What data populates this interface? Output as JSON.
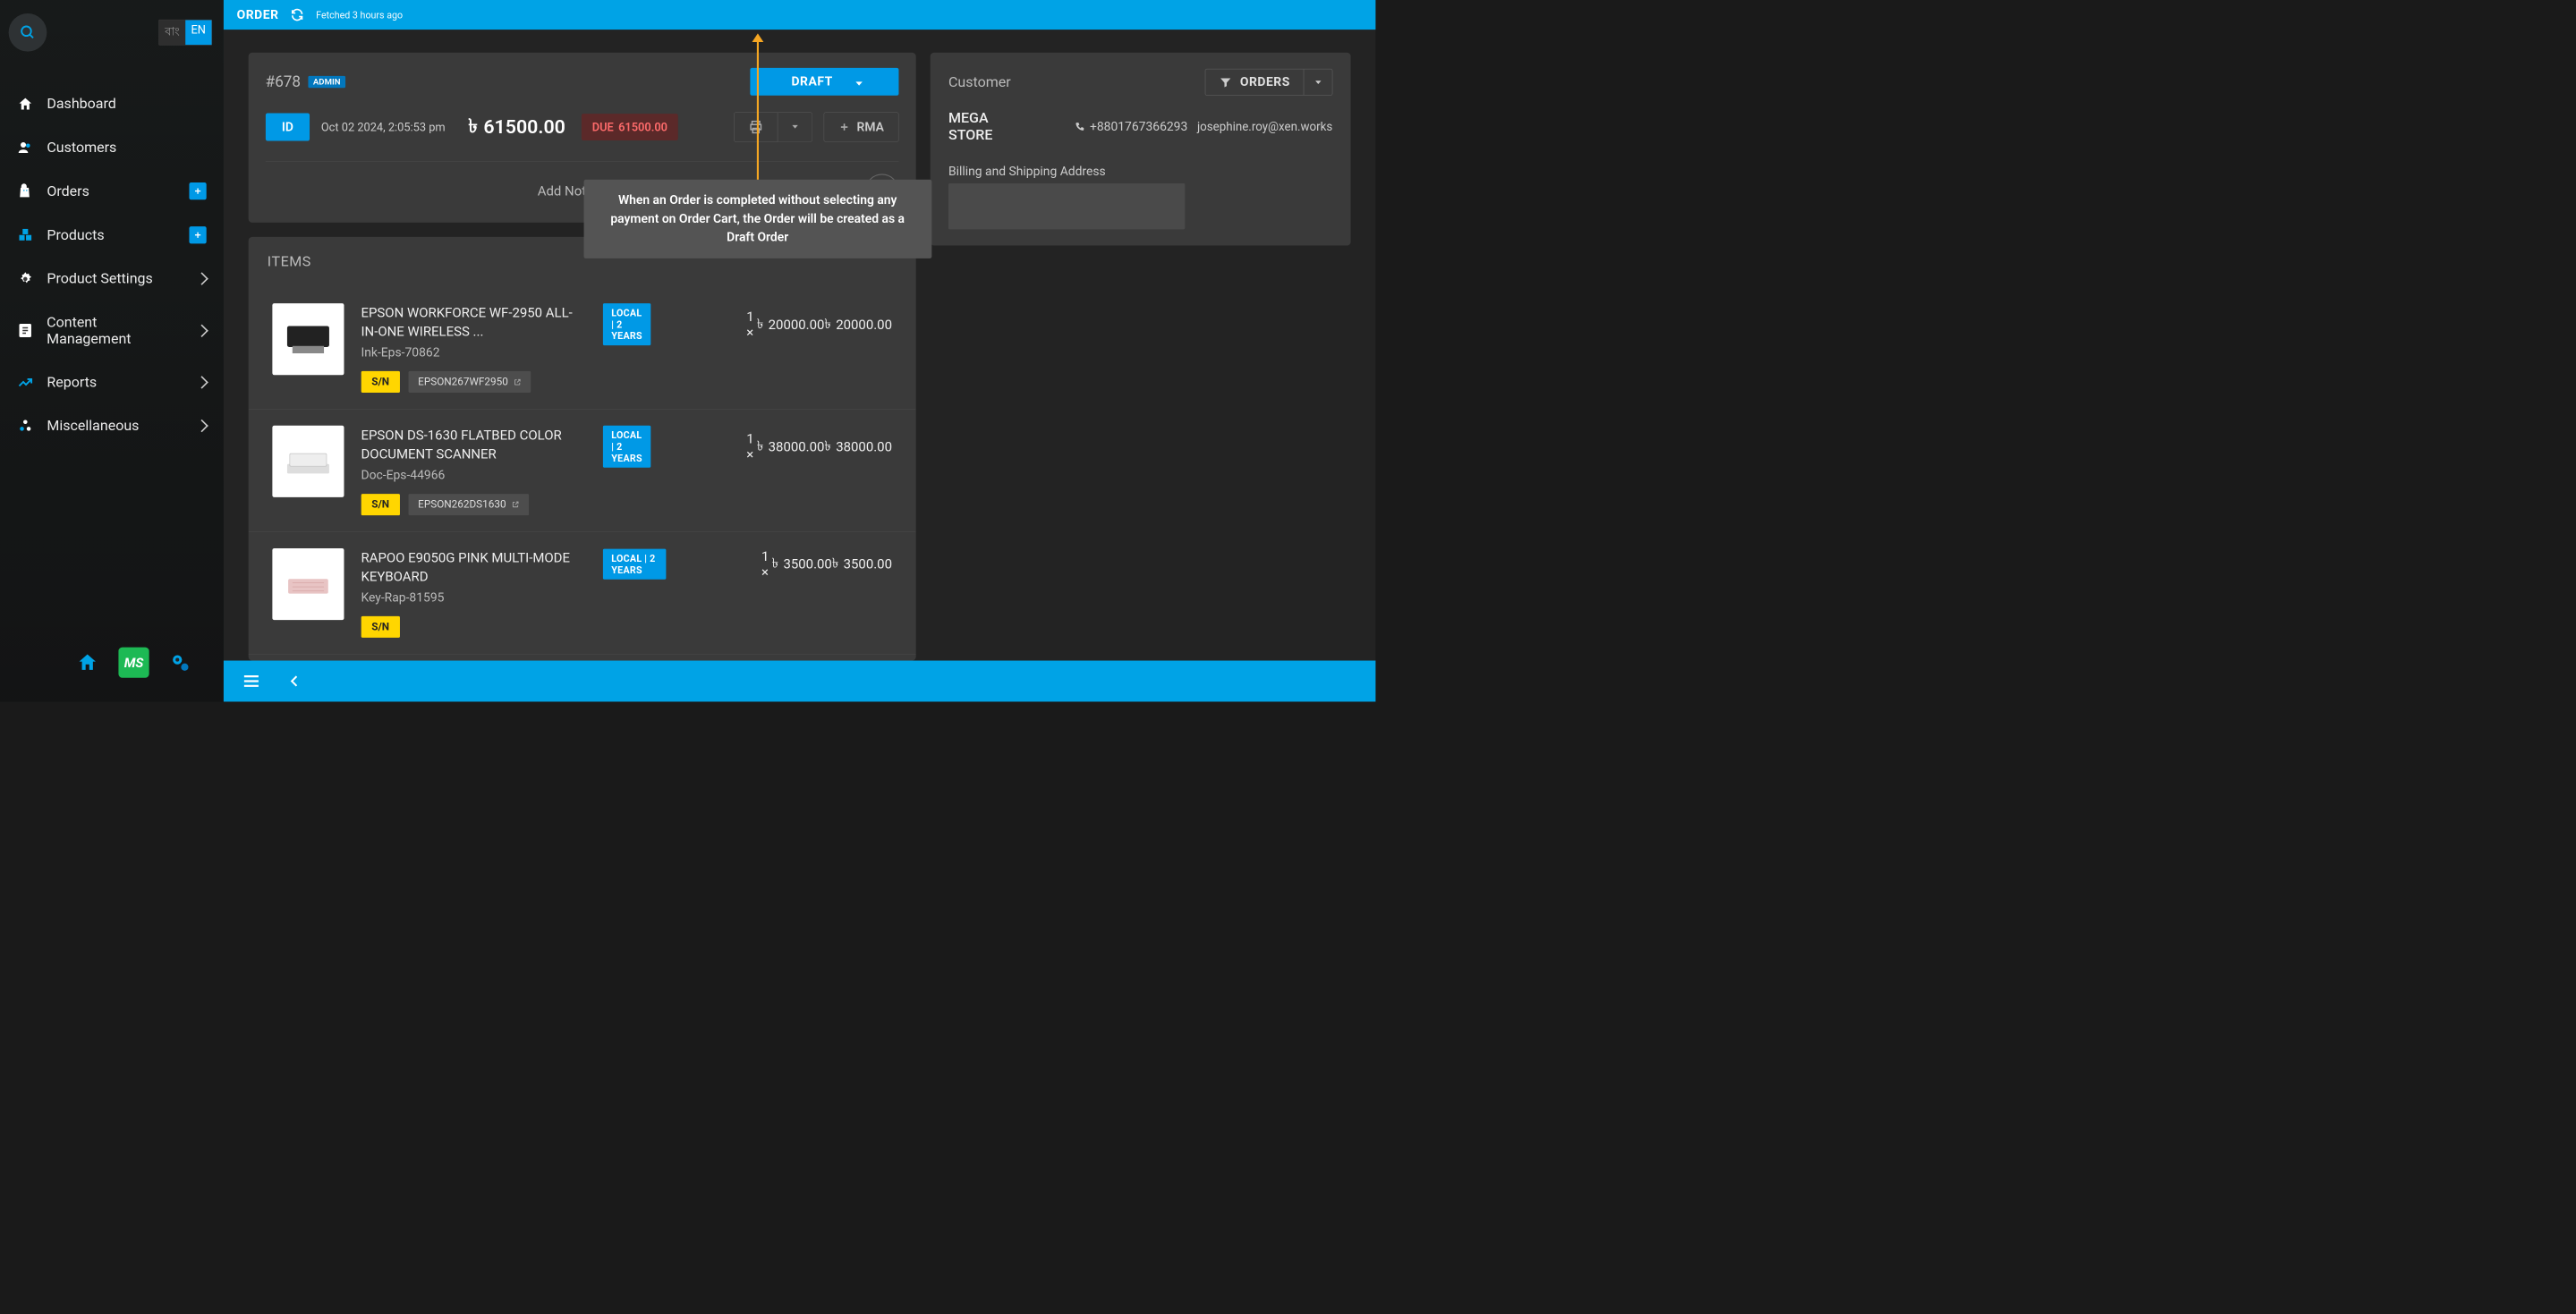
{
  "topbar": {
    "title": "ORDER",
    "fetched": "Fetched 3 hours ago"
  },
  "sidebar": {
    "lang": {
      "bn": "বাং",
      "en": "EN"
    },
    "items": [
      {
        "label": "Dashboard",
        "icon": "home"
      },
      {
        "label": "Customers",
        "icon": "users"
      },
      {
        "label": "Orders",
        "icon": "bag",
        "plus": true
      },
      {
        "label": "Products",
        "icon": "boxes",
        "plus": true
      },
      {
        "label": "Product Settings",
        "icon": "gear",
        "chevron": true
      },
      {
        "label": "Content Management",
        "icon": "doc",
        "chevron": true
      },
      {
        "label": "Reports",
        "icon": "chart",
        "chevron": true
      },
      {
        "label": "Miscellaneous",
        "icon": "misc",
        "chevron": true
      }
    ],
    "bottom": {
      "ms": "MS"
    }
  },
  "order": {
    "id": "#678",
    "admin_badge": "ADMIN",
    "status": "DRAFT",
    "id_badge": "ID",
    "date": "Oct 02 2024, 2:05:53 pm",
    "total": "61500.00",
    "due_label": "DUE",
    "due_amount": "61500.00",
    "rma_label": "RMA",
    "add_note": "Add Note"
  },
  "customer": {
    "title": "Customer",
    "orders_btn": "ORDERS",
    "name": "MEGA STORE",
    "phone": "+8801767366293",
    "email": "josephine.roy@xen.works",
    "addr_title": "Billing and Shipping Address"
  },
  "items_header": "ITEMS",
  "items": [
    {
      "name": "EPSON WORKFORCE WF-2950 ALL-IN-ONE WIRELESS ...",
      "sku": "Ink-Eps-70862",
      "sn_label": "S/N",
      "serial": "EPSON267WF2950",
      "warranty": "LOCAL | 2 YEARS",
      "qty": "1",
      "unit": "20000.00",
      "total": "20000.00"
    },
    {
      "name": "EPSON DS-1630 FLATBED COLOR DOCUMENT SCANNER",
      "sku": "Doc-Eps-44966",
      "sn_label": "S/N",
      "serial": "EPSON262DS1630",
      "warranty": "LOCAL | 2 YEARS",
      "qty": "1",
      "unit": "38000.00",
      "total": "38000.00"
    },
    {
      "name": "RAPOO E9050G PINK MULTI-MODE KEYBOARD",
      "sku": "Key-Rap-81595",
      "sn_label": "S/N",
      "serial": "",
      "warranty": "LOCAL | 2 YEARS",
      "qty": "1",
      "unit": "3500.00",
      "total": "3500.00"
    }
  ],
  "tooltip": "When an Order is completed without selecting any payment on Order Cart, the Order will be created as a Draft Order",
  "currency_glyph": "৳"
}
